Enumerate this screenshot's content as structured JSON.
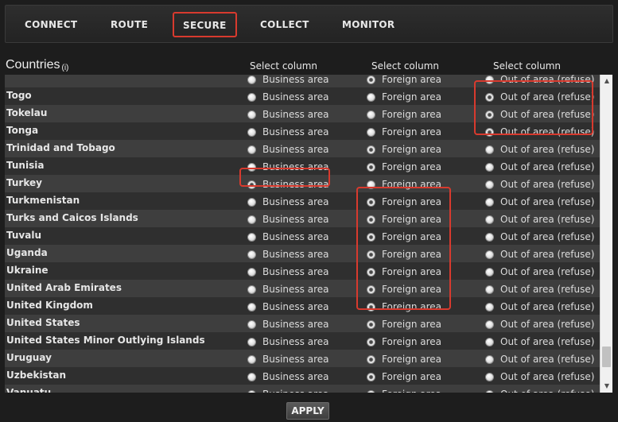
{
  "nav": {
    "tabs": [
      {
        "label": "CONNECT",
        "active": false
      },
      {
        "label": "ROUTE",
        "active": false
      },
      {
        "label": "SECURE",
        "active": true
      },
      {
        "label": "COLLECT",
        "active": false
      },
      {
        "label": "MONITOR",
        "active": false
      }
    ]
  },
  "header": {
    "title": "Countries",
    "info_label": "(i)",
    "column_headers": [
      "Select column",
      "Select column",
      "Select column"
    ]
  },
  "options": {
    "business": "Business area",
    "foreign": "Foreign area",
    "out": "Out of area (refuse)"
  },
  "rows": [
    {
      "country": "",
      "selected": "foreign"
    },
    {
      "country": "Togo",
      "selected": "out"
    },
    {
      "country": "Tokelau",
      "selected": "out"
    },
    {
      "country": "Tonga",
      "selected": "out"
    },
    {
      "country": "Trinidad and Tobago",
      "selected": "foreign"
    },
    {
      "country": "Tunisia",
      "selected": "foreign"
    },
    {
      "country": "Turkey",
      "selected": "business"
    },
    {
      "country": "Turkmenistan",
      "selected": "foreign"
    },
    {
      "country": "Turks and Caicos Islands",
      "selected": "foreign"
    },
    {
      "country": "Tuvalu",
      "selected": "foreign"
    },
    {
      "country": "Uganda",
      "selected": "foreign"
    },
    {
      "country": "Ukraine",
      "selected": "foreign"
    },
    {
      "country": "United Arab Emirates",
      "selected": "foreign"
    },
    {
      "country": "United Kingdom",
      "selected": "foreign"
    },
    {
      "country": "United States",
      "selected": "foreign"
    },
    {
      "country": "United States Minor Outlying Islands",
      "selected": "foreign"
    },
    {
      "country": "Uruguay",
      "selected": "foreign"
    },
    {
      "country": "Uzbekistan",
      "selected": "foreign"
    },
    {
      "country": "Vanuatu",
      "selected": "foreign"
    }
  ],
  "scrollbar": {
    "up_icon": "triangle-up-icon",
    "down_icon": "triangle-down-icon"
  },
  "highlight_color": "#d83a2e",
  "apply_label": "APPLY"
}
